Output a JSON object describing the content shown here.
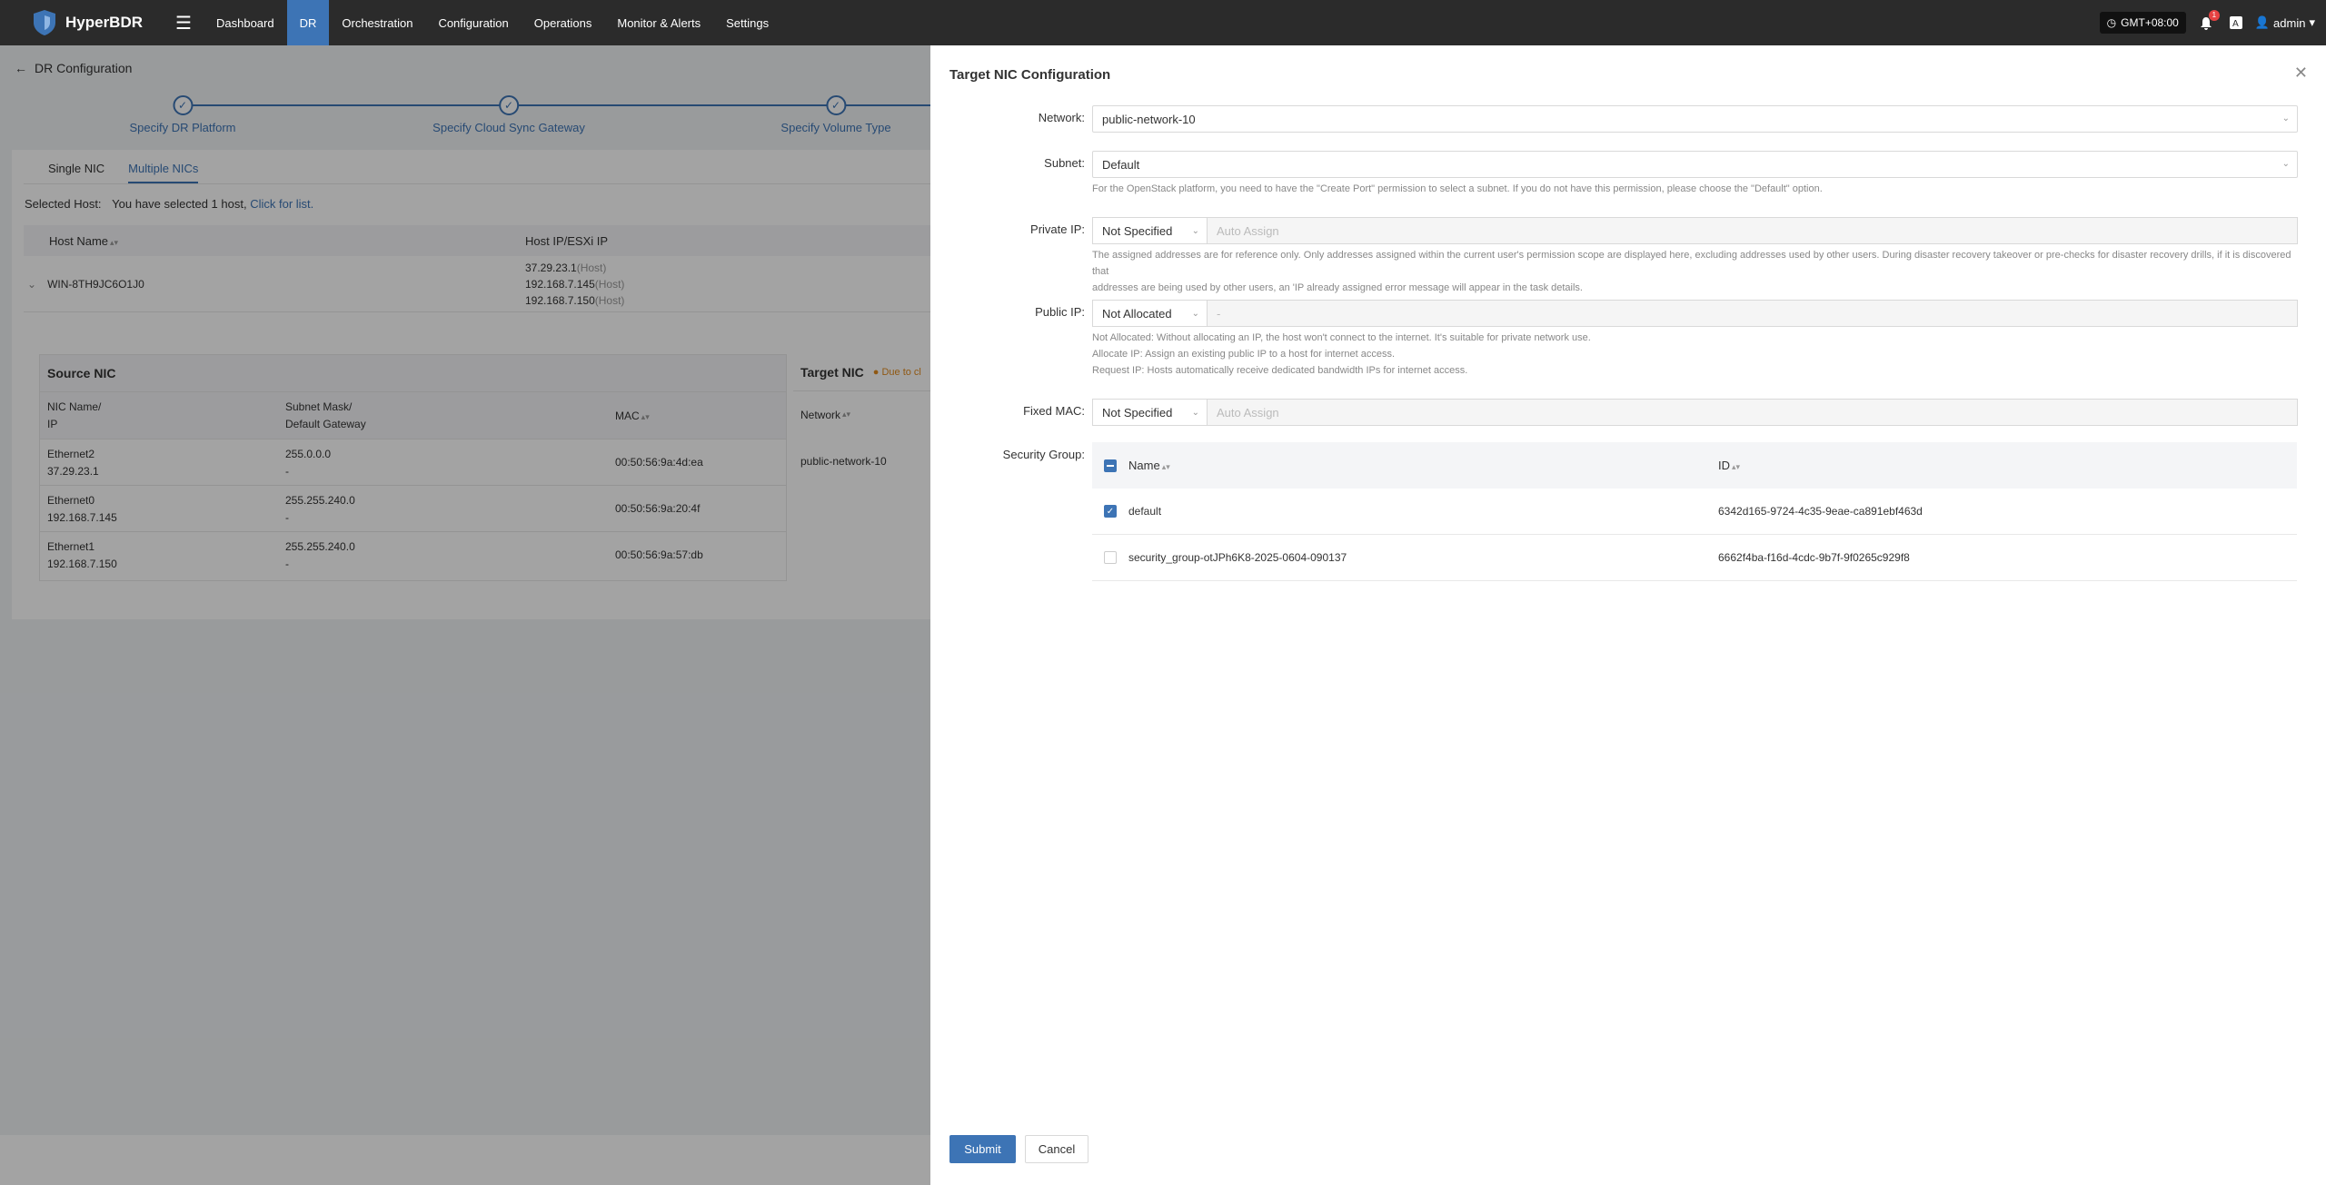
{
  "app": {
    "name": "HyperBDR",
    "nav": [
      "Dashboard",
      "DR",
      "Orchestration",
      "Configuration",
      "Operations",
      "Monitor & Alerts",
      "Settings"
    ],
    "active_nav": "DR",
    "timezone": "GMT+08:00",
    "alerts_count": "1",
    "user": "admin"
  },
  "page": {
    "title": "DR Configuration",
    "steps": [
      "Specify DR Platform",
      "Specify Cloud Sync Gateway",
      "Specify Volume Type"
    ],
    "tabs": [
      "Single NIC",
      "Multiple NICs"
    ],
    "selected_host_label": "Selected Host:",
    "selected_host_text": "You have selected 1 host,",
    "selected_host_link": "Click for list.",
    "host_columns": [
      "Host Name",
      "Host IP/ESXi IP"
    ],
    "host": {
      "name": "WIN-8TH9JC6O1J0",
      "ips": [
        {
          "ip": "37.29.23.1",
          "tag": "(Host)"
        },
        {
          "ip": "192.168.7.145",
          "tag": "(Host)"
        },
        {
          "ip": "192.168.7.150",
          "tag": "(Host)"
        }
      ]
    },
    "source_nic": {
      "title": "Source NIC",
      "col1": [
        "NIC Name/",
        "IP"
      ],
      "col2": [
        "Subnet Mask/",
        "Default Gateway"
      ],
      "col3": "MAC",
      "rows": [
        {
          "name": "Ethernet2",
          "ip": "37.29.23.1",
          "mask": "255.0.0.0",
          "gw": "-",
          "mac": "00:50:56:9a:4d:ea"
        },
        {
          "name": "Ethernet0",
          "ip": "192.168.7.145",
          "mask": "255.255.240.0",
          "gw": "-",
          "mac": "00:50:56:9a:20:4f"
        },
        {
          "name": "Ethernet1",
          "ip": "192.168.7.150",
          "mask": "255.255.240.0",
          "gw": "-",
          "mac": "00:50:56:9a:57:db"
        }
      ]
    },
    "target_nic": {
      "title": "Target NIC",
      "note": "Due to cl",
      "col": "Network",
      "value": "public-network-10"
    }
  },
  "drawer": {
    "title": "Target NIC Configuration",
    "network_label": "Network:",
    "network_value": "public-network-10",
    "subnet_label": "Subnet:",
    "subnet_value": "Default",
    "subnet_hint": "For the OpenStack platform, you need to have the \"Create Port\" permission to select a subnet. If you do not have this permission, please choose the \"Default\" option.",
    "private_ip_label": "Private IP:",
    "private_ip_mode": "Not Specified",
    "private_ip_placeholder": "Auto Assign",
    "private_ip_hint_1": "The assigned addresses are for reference only. Only addresses assigned within the current user's permission scope are displayed here, excluding addresses used by other users. During disaster recovery takeover or pre-checks for disaster recovery drills, if it is discovered that",
    "private_ip_hint_2": "addresses are being used by other users, an 'IP already assigned error message will appear in the task details.",
    "public_ip_label": "Public IP:",
    "public_ip_mode": "Not Allocated",
    "public_ip_value": "-",
    "public_ip_hint_1": "Not Allocated: Without allocating an IP, the host won't connect to the internet. It's suitable for private network use.",
    "public_ip_hint_2": "Allocate IP: Assign an existing public IP to a host for internet access.",
    "public_ip_hint_3": "Request IP: Hosts automatically receive dedicated bandwidth IPs for internet access.",
    "fixed_mac_label": "Fixed MAC:",
    "fixed_mac_mode": "Not Specified",
    "fixed_mac_placeholder": "Auto Assign",
    "security_group_label": "Security Group:",
    "sg_columns": [
      "Name",
      "ID"
    ],
    "security_groups": [
      {
        "name": "default",
        "id": "6342d165-9724-4c35-9eae-ca891ebf463d",
        "checked": true
      },
      {
        "name": "security_group-otJPh6K8-2025-0604-090137",
        "id": "6662f4ba-f16d-4cdc-9b7f-9f0265c929f8",
        "checked": false
      }
    ],
    "submit": "Submit",
    "cancel": "Cancel"
  },
  "colors": {
    "accent": "#3d74b5",
    "topbar": "#2b2b2b",
    "warning": "#e08a1e"
  }
}
